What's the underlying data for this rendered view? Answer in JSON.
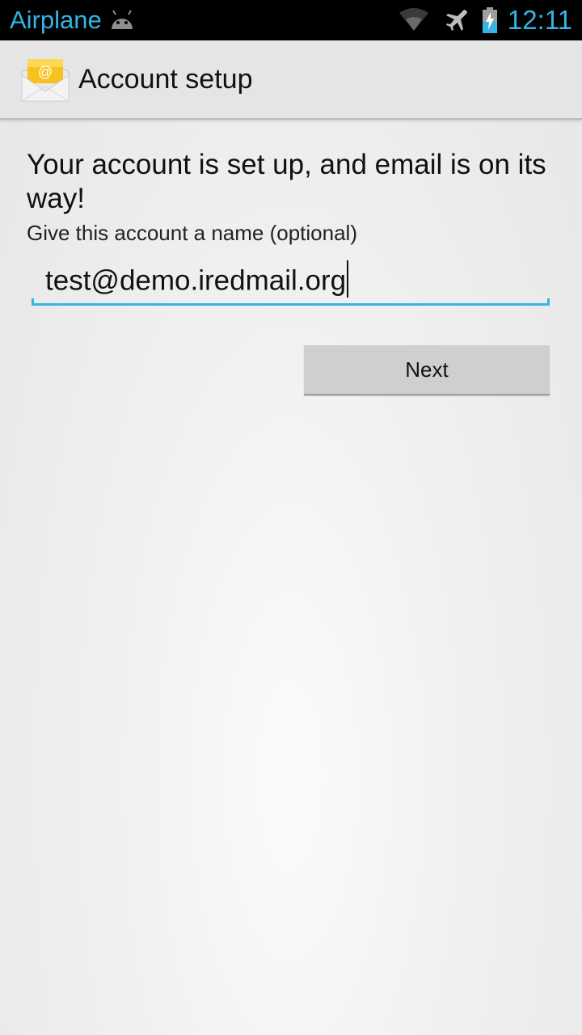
{
  "status_bar": {
    "notification_text": "Airplane",
    "time": "12:11",
    "icons": [
      "android-icon",
      "wifi-icon",
      "airplane-mode-icon",
      "battery-charging-icon"
    ]
  },
  "action_bar": {
    "title": "Account setup",
    "app_icon": "email-envelope-icon"
  },
  "content": {
    "heading": "Your account is set up, and email is on its way!",
    "field_label": "Give this account a name (optional)",
    "account_name_value": "test@demo.iredmail.org",
    "next_label": "Next"
  },
  "colors": {
    "accent": "#33b5e5",
    "status_bar_bg": "#000000",
    "action_bar_bg": "#e5e5e5"
  }
}
